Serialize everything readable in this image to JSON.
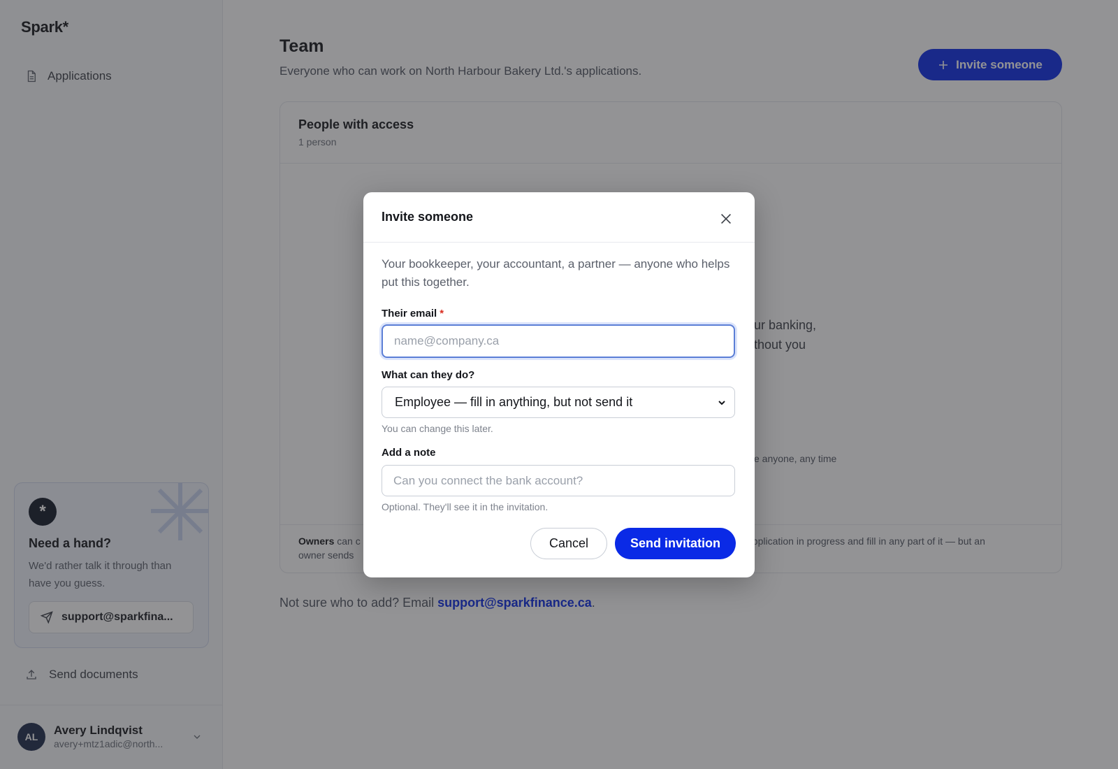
{
  "app": {
    "logo": "Spark*"
  },
  "sidebar": {
    "nav": [
      {
        "label": "Applications",
        "icon": "document-icon"
      }
    ],
    "help": {
      "badge": "*",
      "title": "Need a hand?",
      "text": "We'd rather talk it through than have you guess.",
      "email": "support@sparkfina..."
    },
    "send_documents": "Send documents",
    "user": {
      "initials": "AL",
      "name": "Avery Lindqvist",
      "email": "avery+mtz1adic@north..."
    }
  },
  "main": {
    "title": "Team",
    "subtitle": "Everyone who can work on North Harbour Bakery Ltd.'s applications.",
    "invite_button": "Invite someone",
    "card": {
      "title": "People with access",
      "count": "1 person",
      "bg_line_1": "ur banking,",
      "bg_line_2": "thout you",
      "bg_small": "e anyone, any time",
      "footer_owners": "Owners",
      "footer_start": "can c",
      "footer_end": "application in progress and fill in any part of it — but an",
      "footer_line2": "owner sends"
    },
    "hint_text": "Not sure who to add? Email ",
    "hint_link": "support@sparkfinance.ca",
    "hint_end": "."
  },
  "modal": {
    "title": "Invite someone",
    "intro": "Your bookkeeper, your accountant, a partner — anyone who helps put this together.",
    "email_label": "Their email",
    "email_required": "*",
    "email_placeholder": "name@company.ca",
    "email_value": "",
    "role_label": "What can they do?",
    "role_value": "Employee — fill in anything, but not send it",
    "role_help": "You can change this later.",
    "note_label": "Add a note",
    "note_placeholder": "Can you connect the bank account?",
    "note_help": "Optional. They'll see it in the invitation.",
    "cancel": "Cancel",
    "send": "Send invitation"
  },
  "colors": {
    "accent": "#0a2ae6",
    "required": "#d92d20",
    "overlay": "rgba(40,40,44,0.5)"
  }
}
